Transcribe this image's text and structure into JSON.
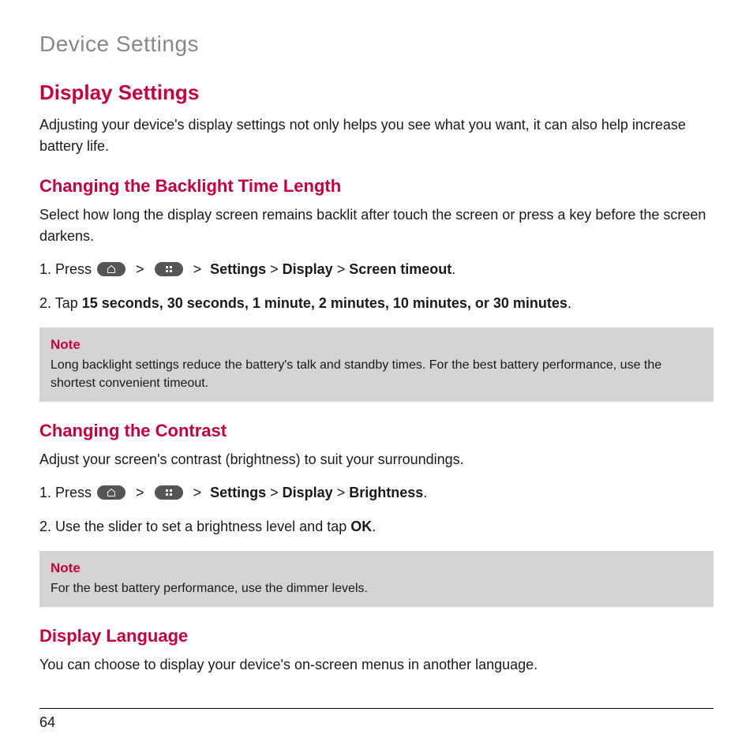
{
  "page_header": "Device Settings",
  "h1": "Display Settings",
  "intro": "Adjusting your device's display settings not only helps you see what you want, it can also help increase battery life.",
  "section1": {
    "heading": "Changing the Backlight Time Length",
    "body": "Select how long the display screen remains backlit after touch the screen or press a key before the screen darkens.",
    "step1_pre": "1. Press ",
    "step1_sep": " > ",
    "step1_path_settings": "Settings",
    "step1_path_display": "Display",
    "step1_path_timeout": "Screen timeout",
    "step1_period": ".",
    "step2_pre": "2. Tap ",
    "step2_bold": "15 seconds, 30 seconds, 1 minute, 2 minutes, 10 minutes, or 30 minutes",
    "step2_period": ".",
    "note_title": "Note",
    "note_text": "Long backlight settings reduce the battery's talk and standby times. For the best battery performance, use the shortest convenient timeout."
  },
  "section2": {
    "heading": "Changing the Contrast",
    "body": "Adjust your screen's contrast (brightness) to suit your surroundings.",
    "step1_pre": "1. Press ",
    "step1_sep": " > ",
    "step1_path_settings": "Settings",
    "step1_path_display": "Display",
    "step1_path_brightness": "Brightness",
    "step1_period": ".",
    "step2_pre": "2. Use the slider to set a brightness level and tap ",
    "step2_bold": "OK",
    "step2_period": ".",
    "note_title": "Note",
    "note_text": "For the best battery performance, use the dimmer levels."
  },
  "section3": {
    "heading": "Display Language",
    "body": "You can choose to display your device's on-screen menus in another language."
  },
  "page_number": "64"
}
